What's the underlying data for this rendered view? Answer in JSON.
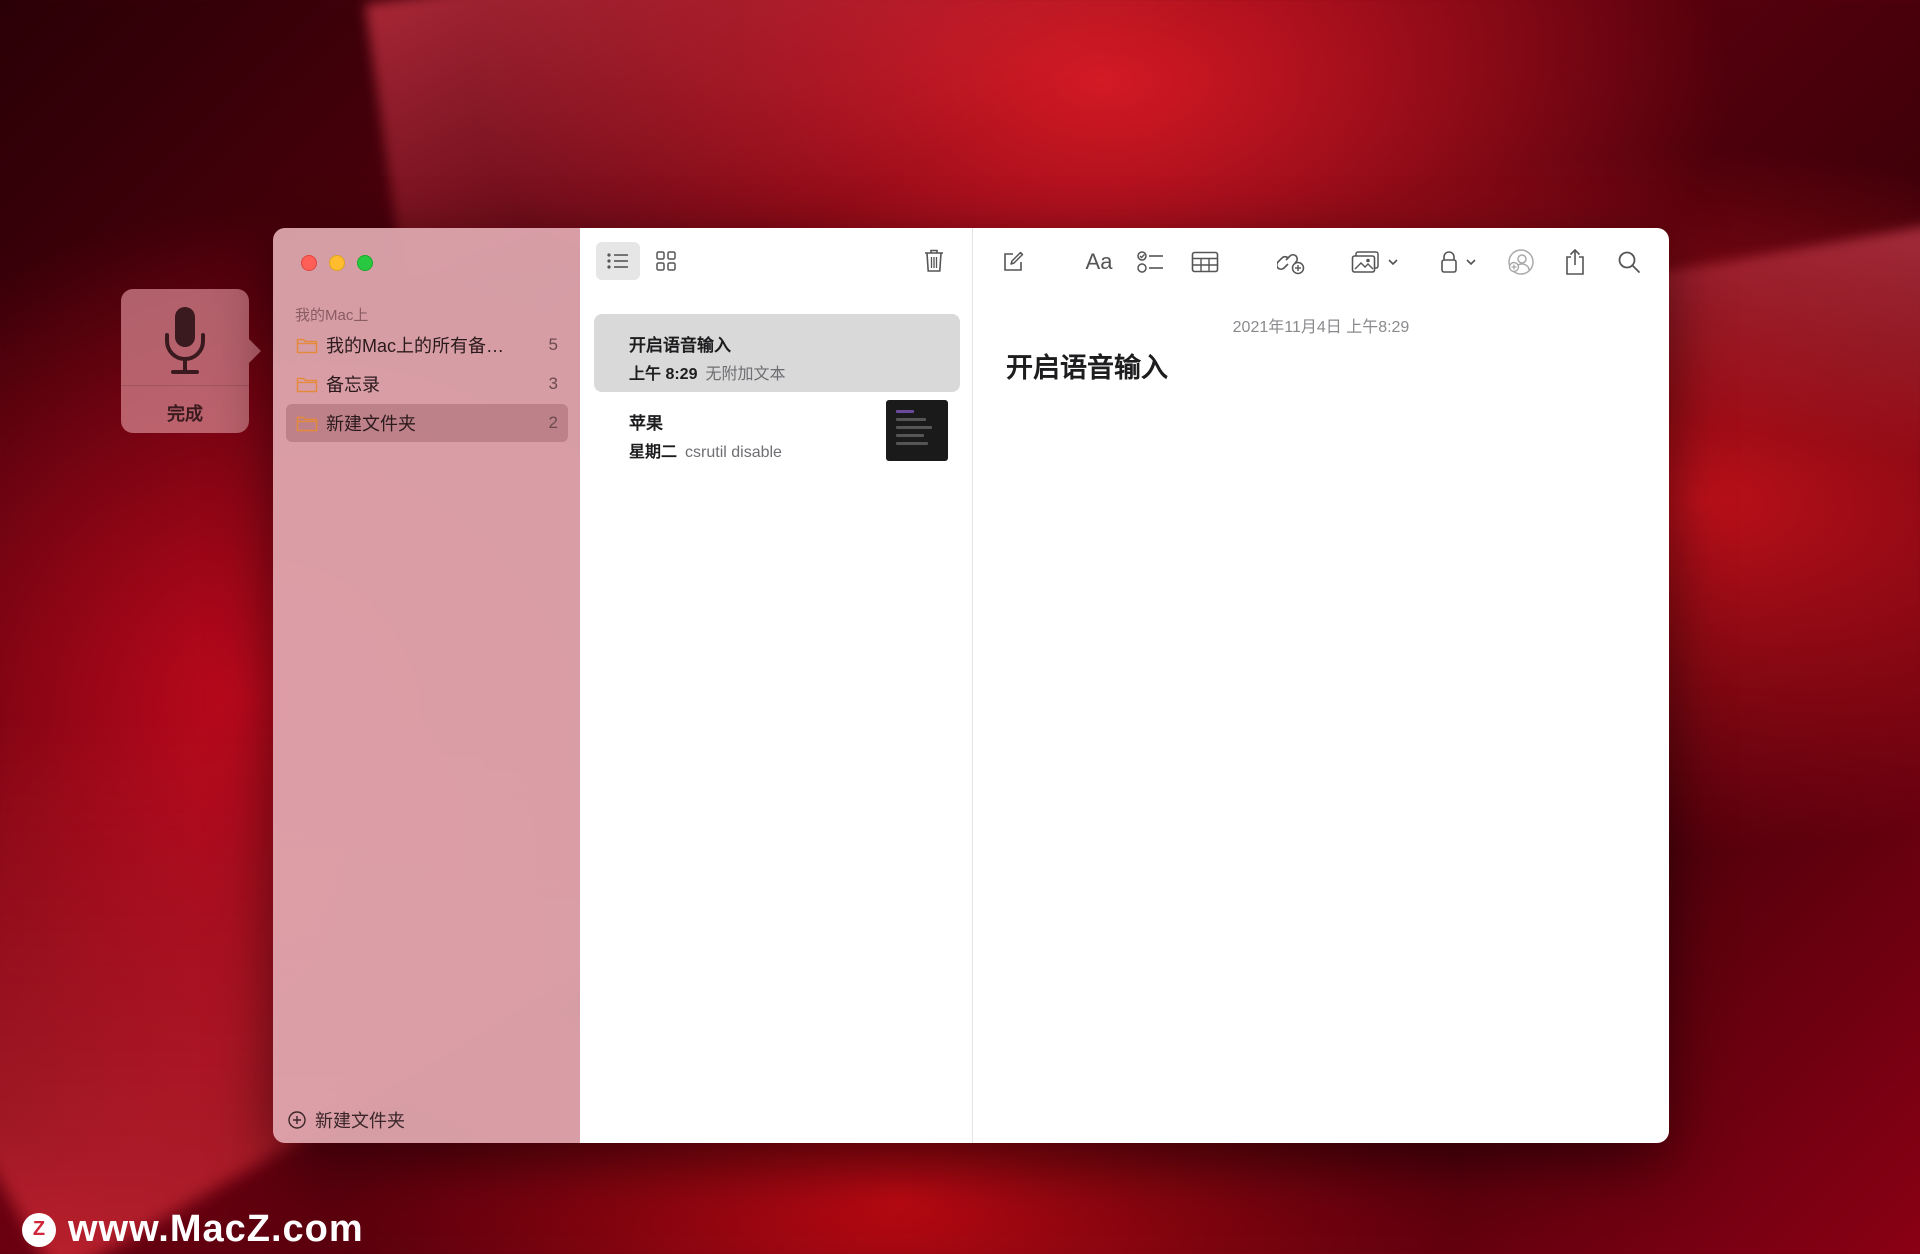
{
  "dictation": {
    "done_label": "完成"
  },
  "sidebar": {
    "section_title": "我的Mac上",
    "folders": [
      {
        "name": "我的Mac上的所有备…",
        "count": "5"
      },
      {
        "name": "备忘录",
        "count": "3"
      },
      {
        "name": "新建文件夹",
        "count": "2"
      }
    ],
    "new_folder_label": "新建文件夹"
  },
  "notes": [
    {
      "title": "开启语音输入",
      "time": "上午 8:29",
      "preview": "无附加文本"
    },
    {
      "title": "苹果",
      "time": "星期二",
      "preview": "csrutil disable"
    }
  ],
  "editor": {
    "date": "2021年11月4日 上午8:29",
    "title": "开启语音输入"
  },
  "toolbar": {
    "format_label": "Aa"
  },
  "watermark": {
    "logo": "Z",
    "url": "www.MacZ.com"
  },
  "colors": {
    "accent_folder": "#e58a3a",
    "selected_note": "#d9d9d9"
  }
}
